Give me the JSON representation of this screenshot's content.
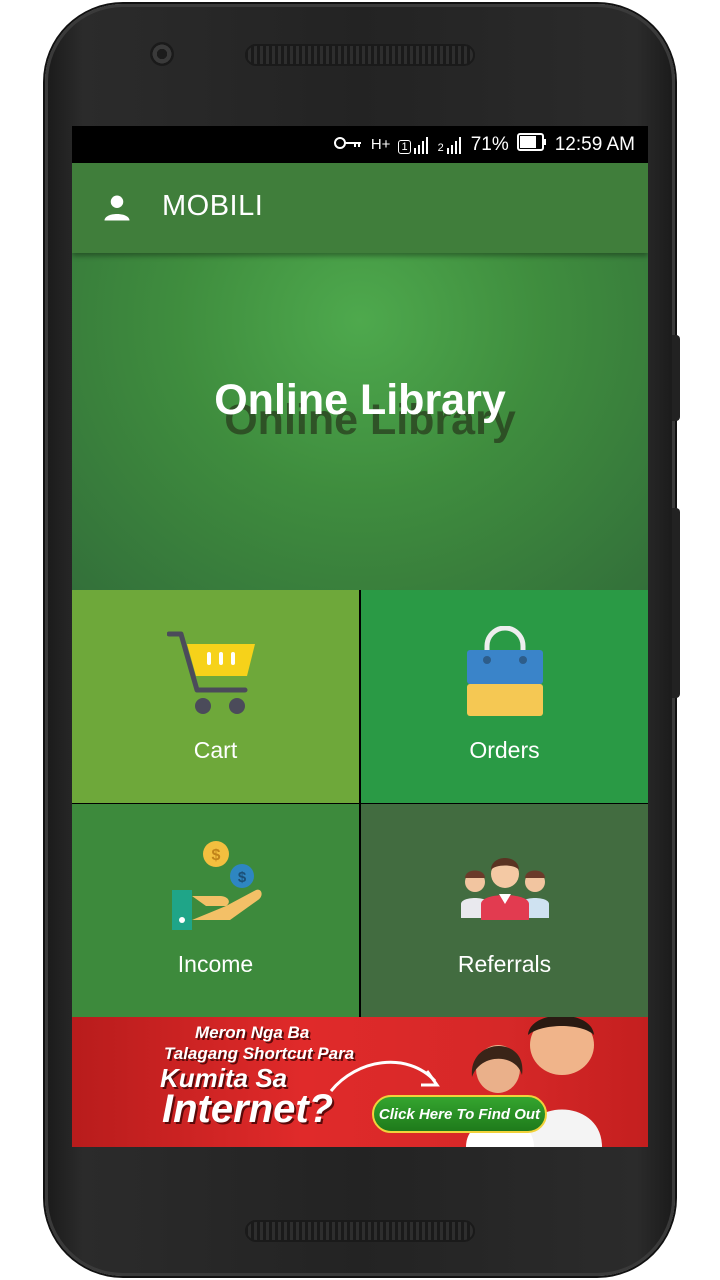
{
  "status_bar": {
    "network": "H+",
    "sim1": "1",
    "sim2": "2",
    "battery": "71%",
    "time": "12:59 AM"
  },
  "app_bar": {
    "title": "MOBILI",
    "icon": "person-icon"
  },
  "hero": {
    "title": "Online Library"
  },
  "tiles": [
    {
      "label": "Cart",
      "icon": "cart-icon",
      "color": "#6ea83a"
    },
    {
      "label": "Orders",
      "icon": "shopping-bag-icon",
      "color": "#2a9a45"
    },
    {
      "label": "Income",
      "icon": "money-hand-icon",
      "color": "#3d8a3c"
    },
    {
      "label": "Referrals",
      "icon": "people-group-icon",
      "color": "#426c40"
    }
  ],
  "ad": {
    "line1": "Meron Nga Ba",
    "line2": "Talagang Shortcut Para",
    "line3": "Kumita Sa",
    "line4": "Internet?",
    "cta": "Click Here To Find Out"
  },
  "colors": {
    "app_bar": "#407e3b",
    "ad_background": "#d62828"
  }
}
